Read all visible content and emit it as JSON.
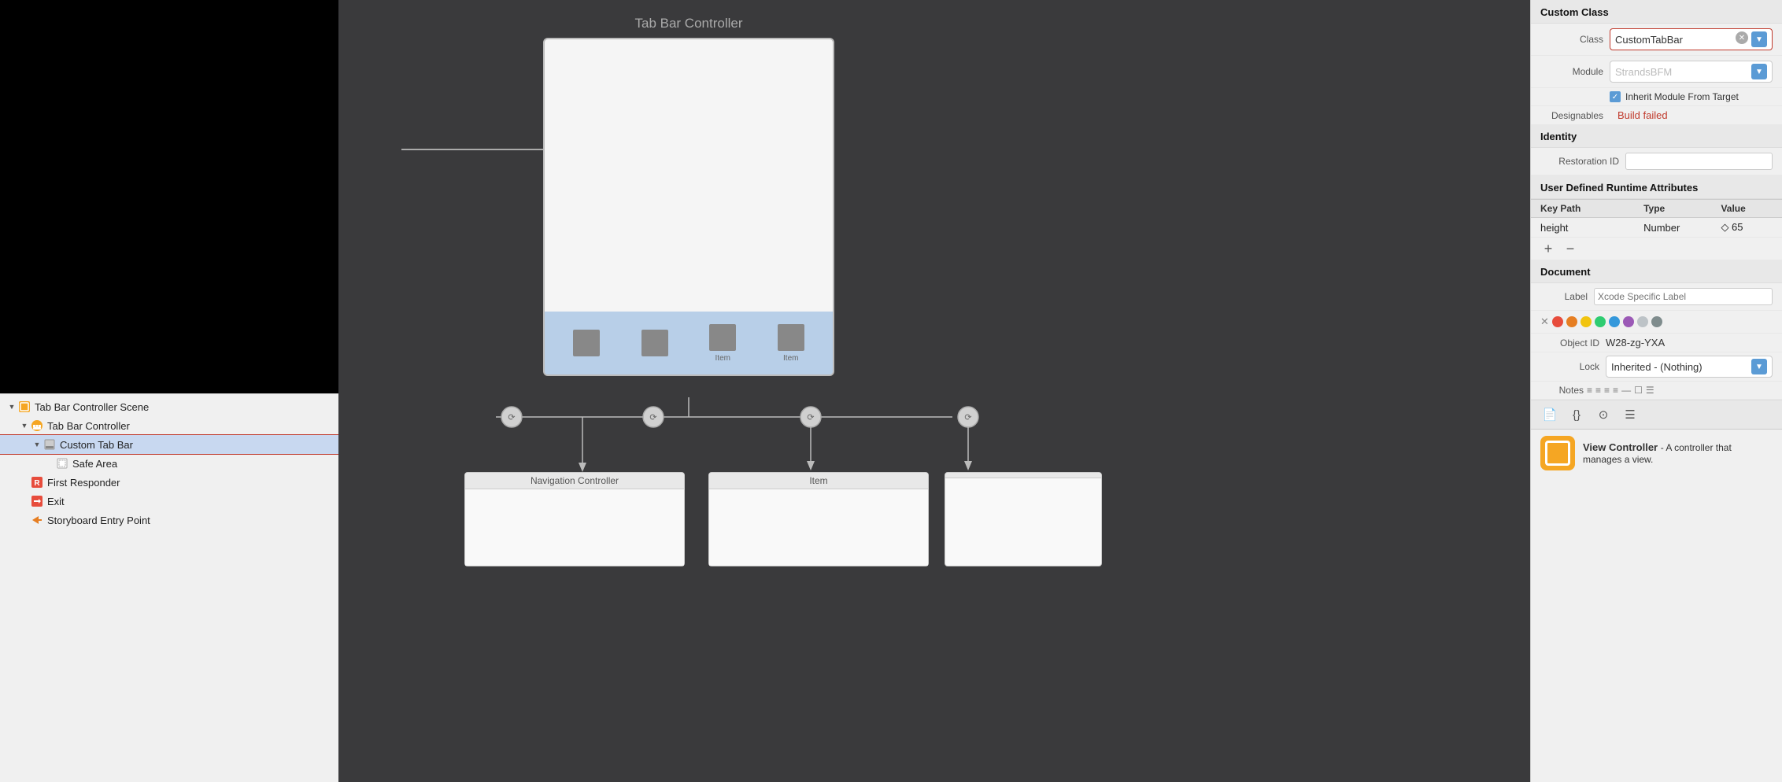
{
  "leftPanel": {
    "treeItems": [
      {
        "id": "scene",
        "label": "Tab Bar Controller Scene",
        "indent": 0,
        "icon": "scene",
        "triangle": "▼",
        "selected": false
      },
      {
        "id": "tbc",
        "label": "Tab Bar Controller",
        "indent": 1,
        "icon": "tabbar",
        "triangle": "▼",
        "selected": false
      },
      {
        "id": "custom",
        "label": "Custom Tab Bar",
        "indent": 2,
        "icon": "custom",
        "triangle": "▼",
        "selected": true
      },
      {
        "id": "safearea",
        "label": "Safe Area",
        "indent": 3,
        "icon": "safearea",
        "triangle": "",
        "selected": false
      },
      {
        "id": "responder",
        "label": "First Responder",
        "indent": 1,
        "icon": "responder",
        "triangle": "",
        "selected": false
      },
      {
        "id": "exit",
        "label": "Exit",
        "indent": 1,
        "icon": "exit",
        "triangle": "",
        "selected": false
      },
      {
        "id": "entry",
        "label": "Storyboard Entry Point",
        "indent": 1,
        "icon": "entry",
        "triangle": "",
        "selected": false
      }
    ]
  },
  "storyboard": {
    "sceneTitle": "Tab Bar Controller",
    "arrowText": "→",
    "tabItems": [
      "Item",
      "Item"
    ],
    "navController": "Navigation Controller",
    "itemController": "Item"
  },
  "rightPanel": {
    "customClass": {
      "sectionTitle": "Custom Class",
      "classLabel": "Class",
      "classValue": "CustomTabBar",
      "moduleLabel": "Module",
      "moduleValue": "StrandsBFM",
      "inheritLabel": "Inherit Module From Target",
      "designablesLabel": "Designables",
      "designablesValue": "Build failed"
    },
    "identity": {
      "sectionTitle": "Identity",
      "restorationLabel": "Restoration ID",
      "restorationValue": ""
    },
    "userDefined": {
      "sectionTitle": "User Defined Runtime Attributes",
      "columns": [
        "Key Path",
        "Type",
        "Value"
      ],
      "rows": [
        {
          "keyPath": "height",
          "type": "Number",
          "value": "◇ 65"
        }
      ]
    },
    "document": {
      "sectionTitle": "Document",
      "labelText": "Label",
      "labelPlaceholder": "Xcode Specific Label",
      "objectIdLabel": "Object ID",
      "objectIdValue": "W28-zg-YXA",
      "lockLabel": "Lock",
      "lockValue": "Inherited - (Nothing)",
      "notesLabel": "Notes",
      "colors": [
        "#e74c3c",
        "#e67e22",
        "#f1c40f",
        "#2ecc71",
        "#3498db",
        "#9b59b6",
        "#bdc3c7",
        "#7f8c8d"
      ]
    },
    "vcInfo": {
      "title": "View Controller",
      "description": "- A controller that manages a view."
    }
  }
}
